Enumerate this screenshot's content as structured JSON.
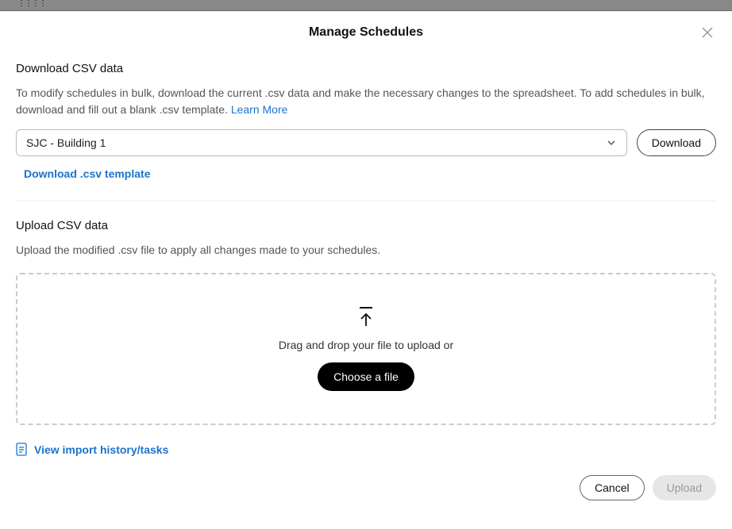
{
  "modal": {
    "title": "Manage Schedules",
    "download": {
      "heading": "Download CSV data",
      "description": "To modify schedules in bulk, download the current .csv data and make the necessary changes to the spreadsheet. To add schedules in bulk, download and fill out a blank .csv template. ",
      "learn_more": "Learn More",
      "select_value": "SJC - Building 1",
      "download_button": "Download",
      "template_link": "Download .csv template"
    },
    "upload": {
      "heading": "Upload CSV data",
      "description": "Upload the modified .csv file to apply all changes made to your schedules.",
      "drop_text": "Drag and drop your file to upload or",
      "choose_button": "Choose a file"
    },
    "history_link": "View import history/tasks",
    "footer": {
      "cancel": "Cancel",
      "upload": "Upload"
    }
  }
}
